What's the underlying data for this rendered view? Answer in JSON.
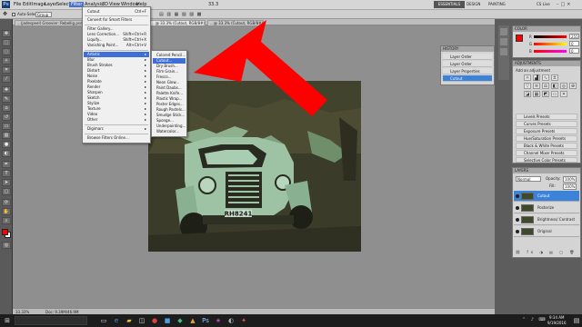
{
  "menubar": {
    "items": [
      "File",
      "Edit",
      "Image",
      "Layer",
      "Select",
      "Filter",
      "Analysis",
      "3D",
      "View",
      "Window",
      "Help"
    ],
    "zoom": "33.3",
    "workspace_buttons": [
      "ESSENTIALS",
      "DESIGN",
      "PAINTING"
    ],
    "cs_live": "CS Live"
  },
  "options": {
    "auto_select": "Auto-Select:",
    "group": "Group"
  },
  "tabs": [
    "...(jadespeel) Groovier: Rebellig.psd @ 33...",
    "...@ 33.3% (Cutout, RGB/8#)",
    "...@ 33.3% (Cutout, RGB/8#)"
  ],
  "filter_menu": {
    "items": [
      {
        "label": "Cutout",
        "shortcut": "Ctrl+F"
      },
      {
        "label": "Convert for Smart Filters",
        "shortcut": ""
      },
      {
        "label": "Filter Gallery...",
        "shortcut": ""
      },
      {
        "label": "Lens Correction...",
        "shortcut": "Shift+Ctrl+R"
      },
      {
        "label": "Liquify...",
        "shortcut": "Shift+Ctrl+X"
      },
      {
        "label": "Vanishing Point...",
        "shortcut": "Alt+Ctrl+V"
      },
      {
        "label": "Artistic",
        "shortcut": ""
      },
      {
        "label": "Blur",
        "shortcut": ""
      },
      {
        "label": "Brush Strokes",
        "shortcut": ""
      },
      {
        "label": "Distort",
        "shortcut": ""
      },
      {
        "label": "Noise",
        "shortcut": ""
      },
      {
        "label": "Pixelate",
        "shortcut": ""
      },
      {
        "label": "Render",
        "shortcut": ""
      },
      {
        "label": "Sharpen",
        "shortcut": ""
      },
      {
        "label": "Sketch",
        "shortcut": ""
      },
      {
        "label": "Stylize",
        "shortcut": ""
      },
      {
        "label": "Texture",
        "shortcut": ""
      },
      {
        "label": "Video",
        "shortcut": ""
      },
      {
        "label": "Other",
        "shortcut": ""
      },
      {
        "label": "Digimarc",
        "shortcut": ""
      },
      {
        "label": "Browse Filters Online...",
        "shortcut": ""
      }
    ]
  },
  "artistic_submenu": {
    "items": [
      "Colored Pencil...",
      "Cutout...",
      "Dry Brush...",
      "Film Grain...",
      "Fresco...",
      "Neon Glow...",
      "Paint Daubs...",
      "Palette Knife...",
      "Plastic Wrap...",
      "Poster Edges...",
      "Rough Pastels...",
      "Smudge Stick...",
      "Sponge...",
      "Underpainting...",
      "Watercolor..."
    ]
  },
  "history_panel": {
    "title": "HISTORY",
    "items": [
      "Layer Order",
      "Layer Order",
      "Layer Properties",
      "Cutout"
    ]
  },
  "color_panel": {
    "title": "COLOR",
    "channels": [
      {
        "label": "R",
        "value": "255"
      },
      {
        "label": "G",
        "value": "0"
      },
      {
        "label": "B",
        "value": "0"
      }
    ]
  },
  "adjustments_panel": {
    "title": "ADJUSTMENTS",
    "subtitle": "Add an adjustment",
    "presets": [
      "Levels Presets",
      "Curves Presets",
      "Exposure Presets",
      "Hue/Saturation Presets",
      "Black & White Presets",
      "Channel Mixer Presets",
      "Selective Color Presets"
    ]
  },
  "layers_panel": {
    "title": "LAYERS",
    "blend": "Normal",
    "opacity_label": "Opacity:",
    "opacity": "100%",
    "fill_label": "Fill:",
    "fill": "100%",
    "layers": [
      "Cutout",
      "Posterize",
      "Brightness/ Contrast",
      "Original"
    ]
  },
  "status": {
    "zoom": "33.33%",
    "doc": "Doc: 9.39M/46.9M"
  },
  "photo": {
    "plate": "RH8241"
  },
  "taskbar": {
    "time": "9:34 AM",
    "date": "9/19/2016"
  },
  "colors": {
    "menu_highlight": "#3e6ed6",
    "arrow": "#ff0000",
    "foreground": "#ff0000",
    "layer_selected": "#3b82d8"
  }
}
